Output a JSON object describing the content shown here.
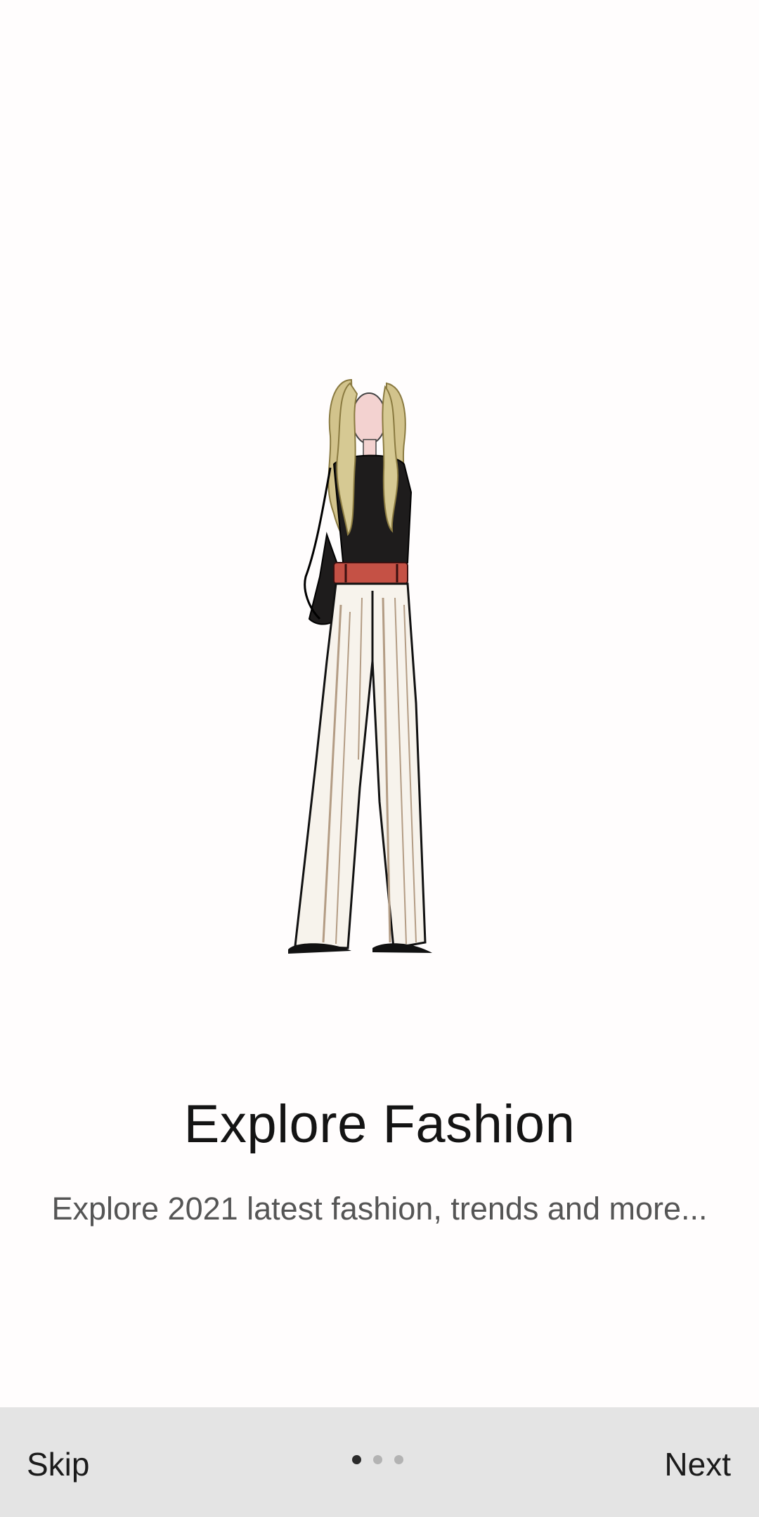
{
  "onboarding": {
    "illustration": "fashion-woman-illustration",
    "title": "Explore Fashion",
    "subtitle": "Explore 2021 latest fashion, trends and more..."
  },
  "bottom_bar": {
    "skip_label": "Skip",
    "next_label": "Next",
    "page_indicator": {
      "current": 1,
      "total": 3
    }
  },
  "colors": {
    "background": "#fffdfd",
    "bottom_bar": "#e4e4e4",
    "dot_active": "#2b2b2b",
    "dot_inactive": "#b3b3b3"
  }
}
